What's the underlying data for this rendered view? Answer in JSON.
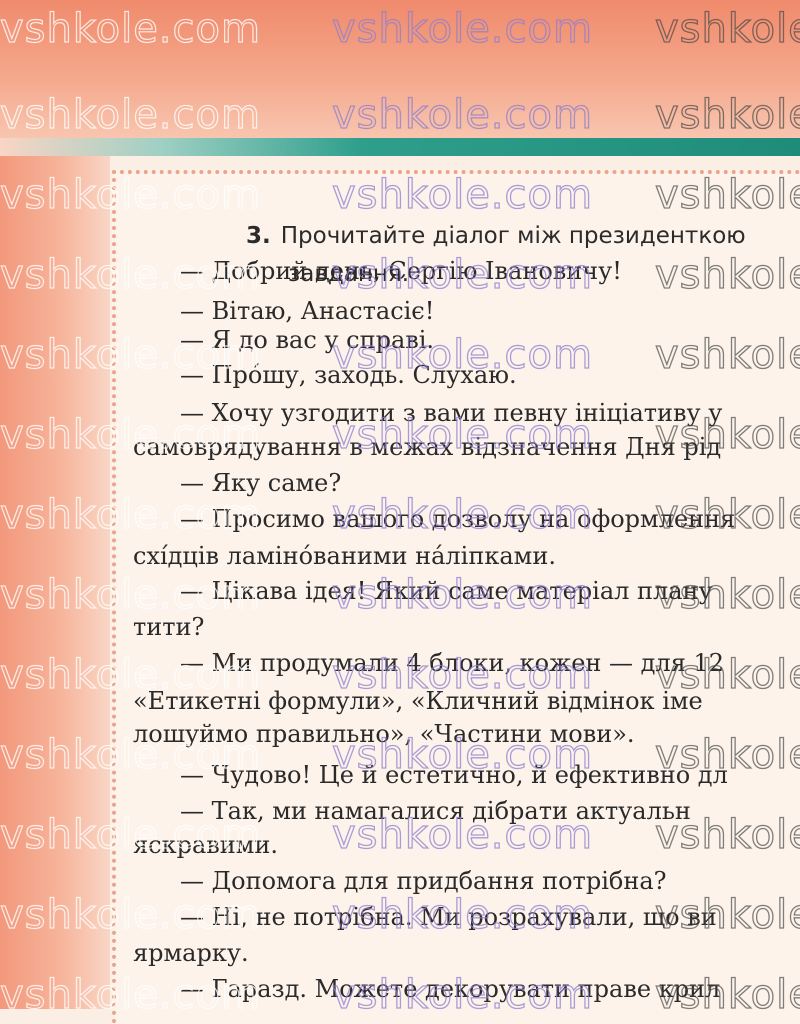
{
  "task": {
    "number": "3.",
    "text": "Прочитайте діалог між президенткою",
    "continuation": "завдання."
  },
  "dialogue_lines": [
    {
      "text": "— Добрий день, Сергію Івановичу!",
      "indent": true
    },
    {
      "text": "— Вітаю, Анастасіє!",
      "indent": true
    },
    {
      "text": "— Я до вас у справі.",
      "indent": true
    },
    {
      "text": "— Про́шу, заходь. Слухаю.",
      "indent": true
    },
    {
      "text": "— Хочу узгодити з вами певну ініціативу у",
      "indent": true
    },
    {
      "text": "самоврядування в межах відзначення Дня рід",
      "indent": false
    },
    {
      "text": "— Яку саме?",
      "indent": true
    },
    {
      "text": "— Просимо вашого дозволу на оформлення",
      "indent": true
    },
    {
      "text": "схі́дців ламіно́ваними на́ліпками.",
      "indent": false
    },
    {
      "text": "— Цікава ідея! Який саме матеріал плану",
      "indent": true
    },
    {
      "text": "тити?",
      "indent": false
    },
    {
      "text": "— Ми продумали 4 блоки, кожен — для 12",
      "indent": true
    },
    {
      "text": "«Етикетні формули», «Кличний відмінок іме",
      "indent": false
    },
    {
      "text": "лошуймо правильно», «Частини мови».",
      "indent": false
    },
    {
      "text": "— Чудово! Це й естетично, й ефективно дл",
      "indent": true
    },
    {
      "text": "— Так, ми намагалися дібрати актуальн",
      "indent": true
    },
    {
      "text": "яскравими.",
      "indent": false
    },
    {
      "text": "— Допомога для придбання потрібна?",
      "indent": true
    },
    {
      "text": "— Ні, не потрібна. Ми розрахували, що ви",
      "indent": true
    },
    {
      "text": "ярмарку.",
      "indent": false
    },
    {
      "text": "— Гаразд. Можете декорувати праве крил",
      "indent": true
    }
  ],
  "watermark": "vshkole.com"
}
